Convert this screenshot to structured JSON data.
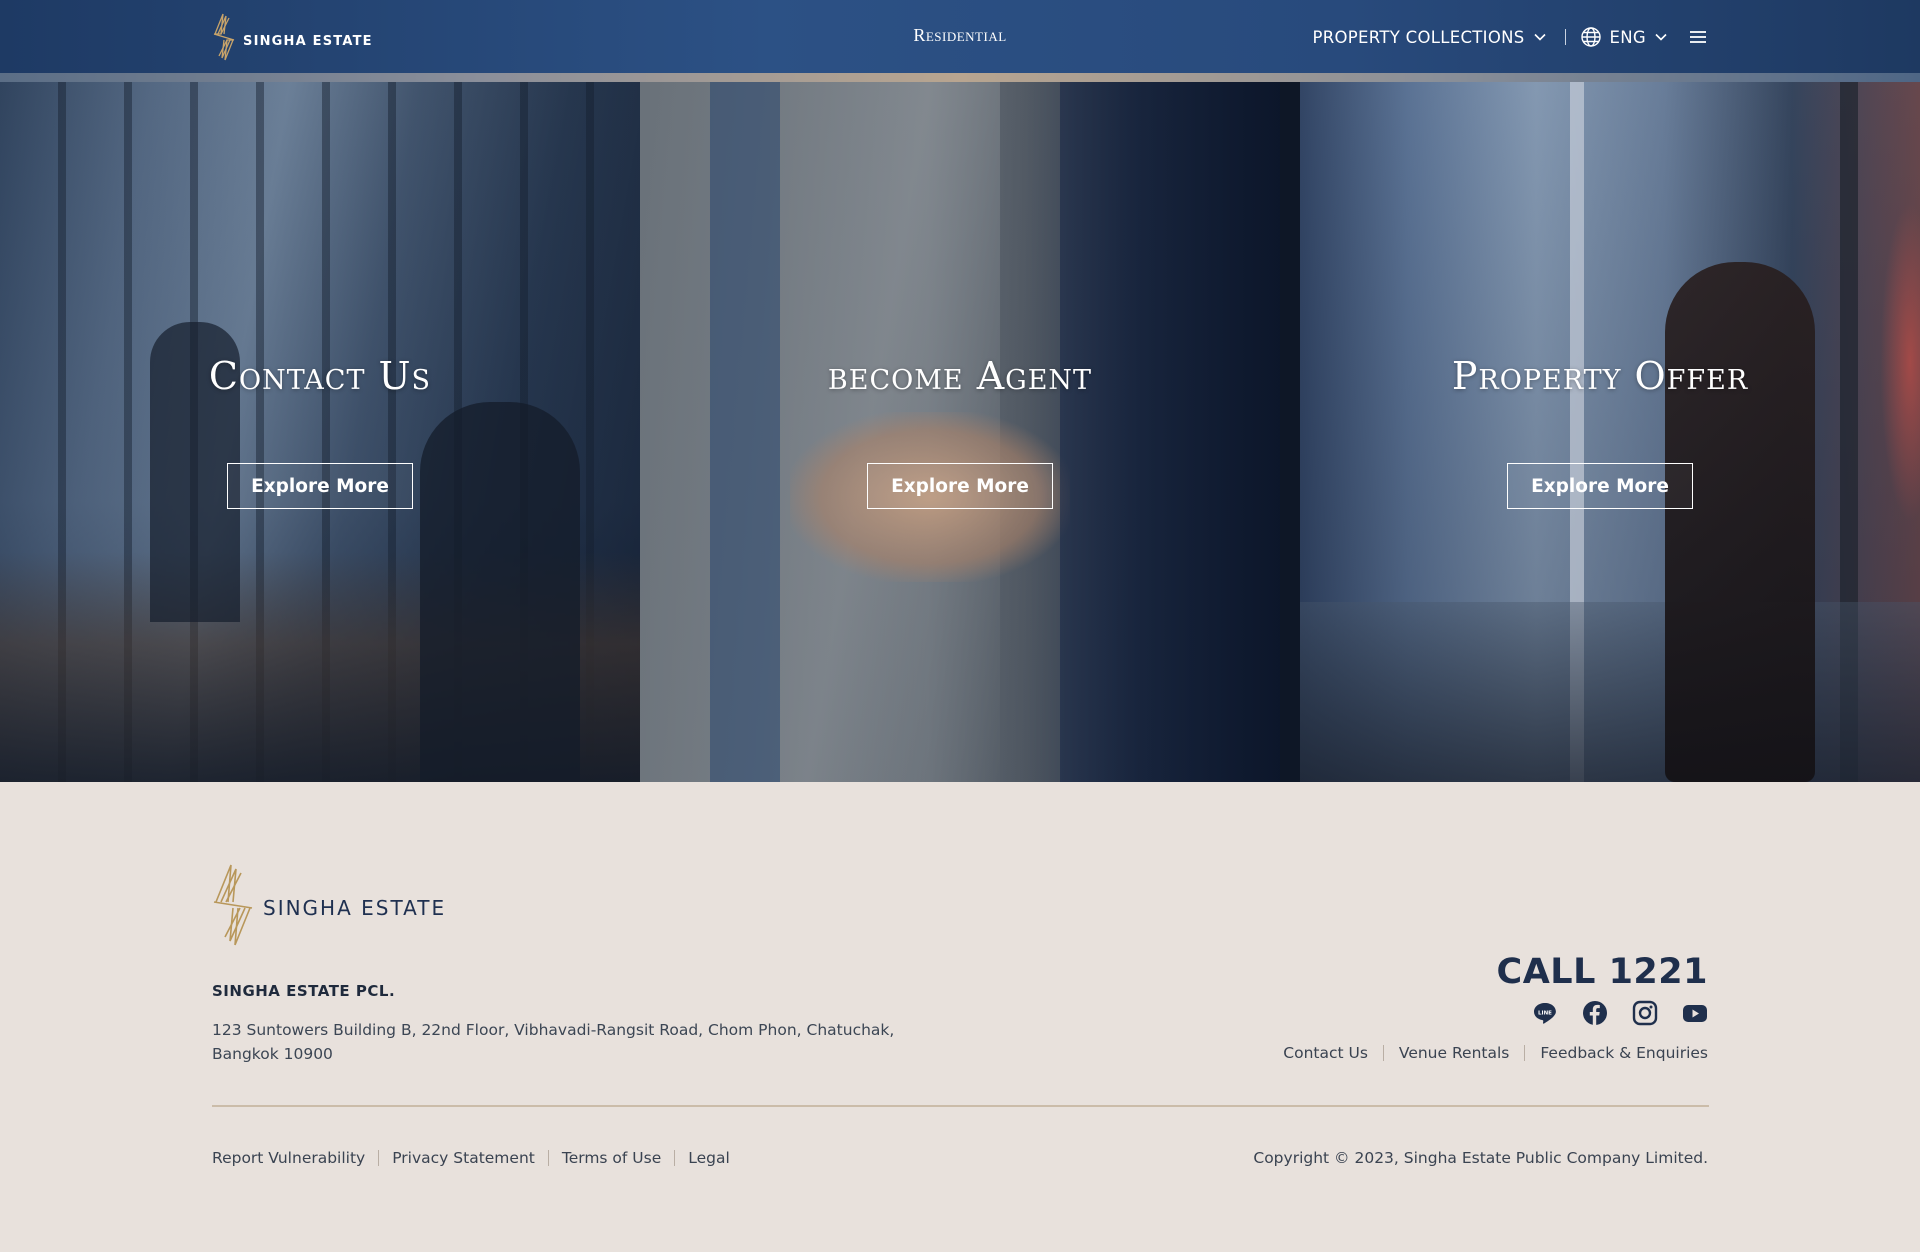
{
  "header": {
    "brand_text": "SINGHA ESTATE",
    "center_title": "Residential",
    "nav_collections": "PROPERTY COLLECTIONS",
    "nav_language": "ENG",
    "colors": {
      "bg": "#2a4b7e",
      "accent": "#b8975a"
    }
  },
  "hero": {
    "panels": [
      {
        "title": "Contact Us",
        "button": "Explore More"
      },
      {
        "title": "become Agent",
        "button": "Explore More"
      },
      {
        "title": "Property Offer",
        "button": "Explore More"
      }
    ]
  },
  "footer": {
    "logo_text": "SINGHA ESTATE",
    "company": "SINGHA ESTATE PCL.",
    "address_line1": "123 Suntowers Building B, 22nd Floor, Vibhavadi-Rangsit Road, Chom Phon, Chatuchak,",
    "address_line2": "Bangkok 10900",
    "call": "CALL 1221",
    "socials": [
      "line-icon",
      "facebook-icon",
      "instagram-icon",
      "youtube-icon"
    ],
    "links_right": [
      "Contact Us",
      "Venue Rentals",
      "Feedback & Enquiries"
    ],
    "legal_links": [
      "Report Vulnerability",
      "Privacy Statement",
      "Terms of Use",
      "Legal"
    ],
    "copyright": "Copyright © 2023, Singha Estate Public Company Limited."
  }
}
